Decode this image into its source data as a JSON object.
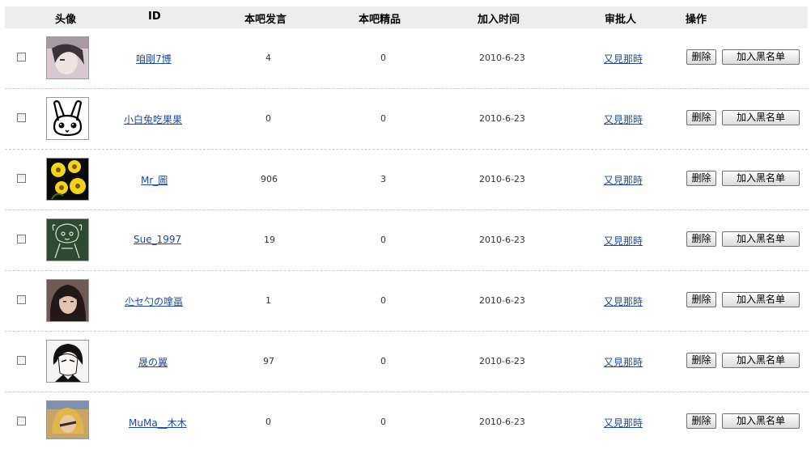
{
  "header": {
    "avatar": "头像",
    "id": "ID",
    "posts": "本吧发言",
    "featured": "本吧精品",
    "joined": "加入时间",
    "approver": "审批人",
    "actions": "操作"
  },
  "buttons": {
    "delete": "删除",
    "blacklist": "加入黑名单"
  },
  "rows": [
    {
      "avatar_icon": "photo-girl-icon",
      "id": "咱剛7博",
      "posts": "4",
      "featured": "0",
      "joined": "2010-6-23",
      "approver": "又見那時"
    },
    {
      "avatar_icon": "rabbit-icon",
      "id": "小白兔吃果果",
      "posts": "0",
      "featured": "0",
      "joined": "2010-6-23",
      "approver": "又見那時"
    },
    {
      "avatar_icon": "sunflower-icon",
      "id": "Mr_圖",
      "posts": "906",
      "featured": "3",
      "joined": "2010-6-23",
      "approver": "又見那時"
    },
    {
      "avatar_icon": "sketch-girl-icon",
      "id": "Sue_1997",
      "posts": "19",
      "featured": "0",
      "joined": "2010-6-23",
      "approver": "又見那時"
    },
    {
      "avatar_icon": "photo-portrait-icon",
      "id": "尐セ勺の嗱畐",
      "posts": "1",
      "featured": "0",
      "joined": "2010-6-23",
      "approver": "又見那時"
    },
    {
      "avatar_icon": "anime-butler-icon",
      "id": "晟の翼",
      "posts": "97",
      "featured": "0",
      "joined": "2010-6-23",
      "approver": "又見那時"
    },
    {
      "avatar_icon": "photo-blonde-icon",
      "id": "MuMa__木木",
      "posts": "0",
      "featured": "0",
      "joined": "2010-6-23",
      "approver": "又見那時"
    }
  ]
}
